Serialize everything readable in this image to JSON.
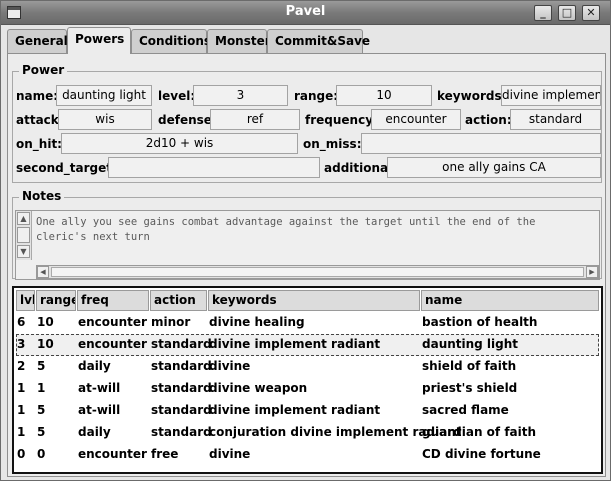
{
  "window": {
    "title": "Pavel",
    "buttons": [
      "_",
      "□",
      "✕"
    ]
  },
  "tabs": [
    {
      "label": "General"
    },
    {
      "label": "Powers"
    },
    {
      "label": "Conditions"
    },
    {
      "label": "Monster"
    },
    {
      "label": "Commit&Save"
    }
  ],
  "power": {
    "legend": "Power",
    "name_label": "name:",
    "name": "daunting light",
    "level_label": "level:",
    "level": "3",
    "range_label": "range:",
    "range": "10",
    "keywords_label": "keywords:",
    "keywords": "divine implement",
    "attack_label": "attack:",
    "attack": "wis",
    "defense_label": "defense:",
    "defense": "ref",
    "frequency_label": "frequency:",
    "frequency": "encounter",
    "action_label": "action:",
    "action": "standard",
    "on_hit_label": "on_hit:",
    "on_hit": "2d10 + wis",
    "on_miss_label": "on_miss:",
    "on_miss": "",
    "second_target_label": "second_target:",
    "second_target": "",
    "additional_label": "additional:",
    "additional": "one ally gains CA"
  },
  "notes": {
    "legend": "Notes",
    "line1": "One ally you see gains combat advantage against the target until the end of the",
    "line2": "cleric's next turn"
  },
  "table": {
    "headers": [
      "lvl",
      "range",
      "freq",
      "action",
      "keywords",
      "name"
    ],
    "rows": [
      [
        "6",
        "10",
        "encounter",
        "minor",
        "divine healing",
        "bastion of health"
      ],
      [
        "3",
        "10",
        "encounter",
        "standard",
        "divine implement radiant",
        "daunting light"
      ],
      [
        "2",
        "5",
        "daily",
        "standard",
        "divine",
        "shield of faith"
      ],
      [
        "1",
        "1",
        "at-will",
        "standard",
        "divine weapon",
        "priest's shield"
      ],
      [
        "1",
        "5",
        "at-will",
        "standard",
        "divine implement radiant",
        "sacred flame"
      ],
      [
        "1",
        "5",
        "daily",
        "standard",
        "conjuration divine implement radiant",
        "guardian of faith"
      ],
      [
        "0",
        "0",
        "encounter",
        "free",
        "divine",
        "CD divine fortune"
      ]
    ]
  }
}
